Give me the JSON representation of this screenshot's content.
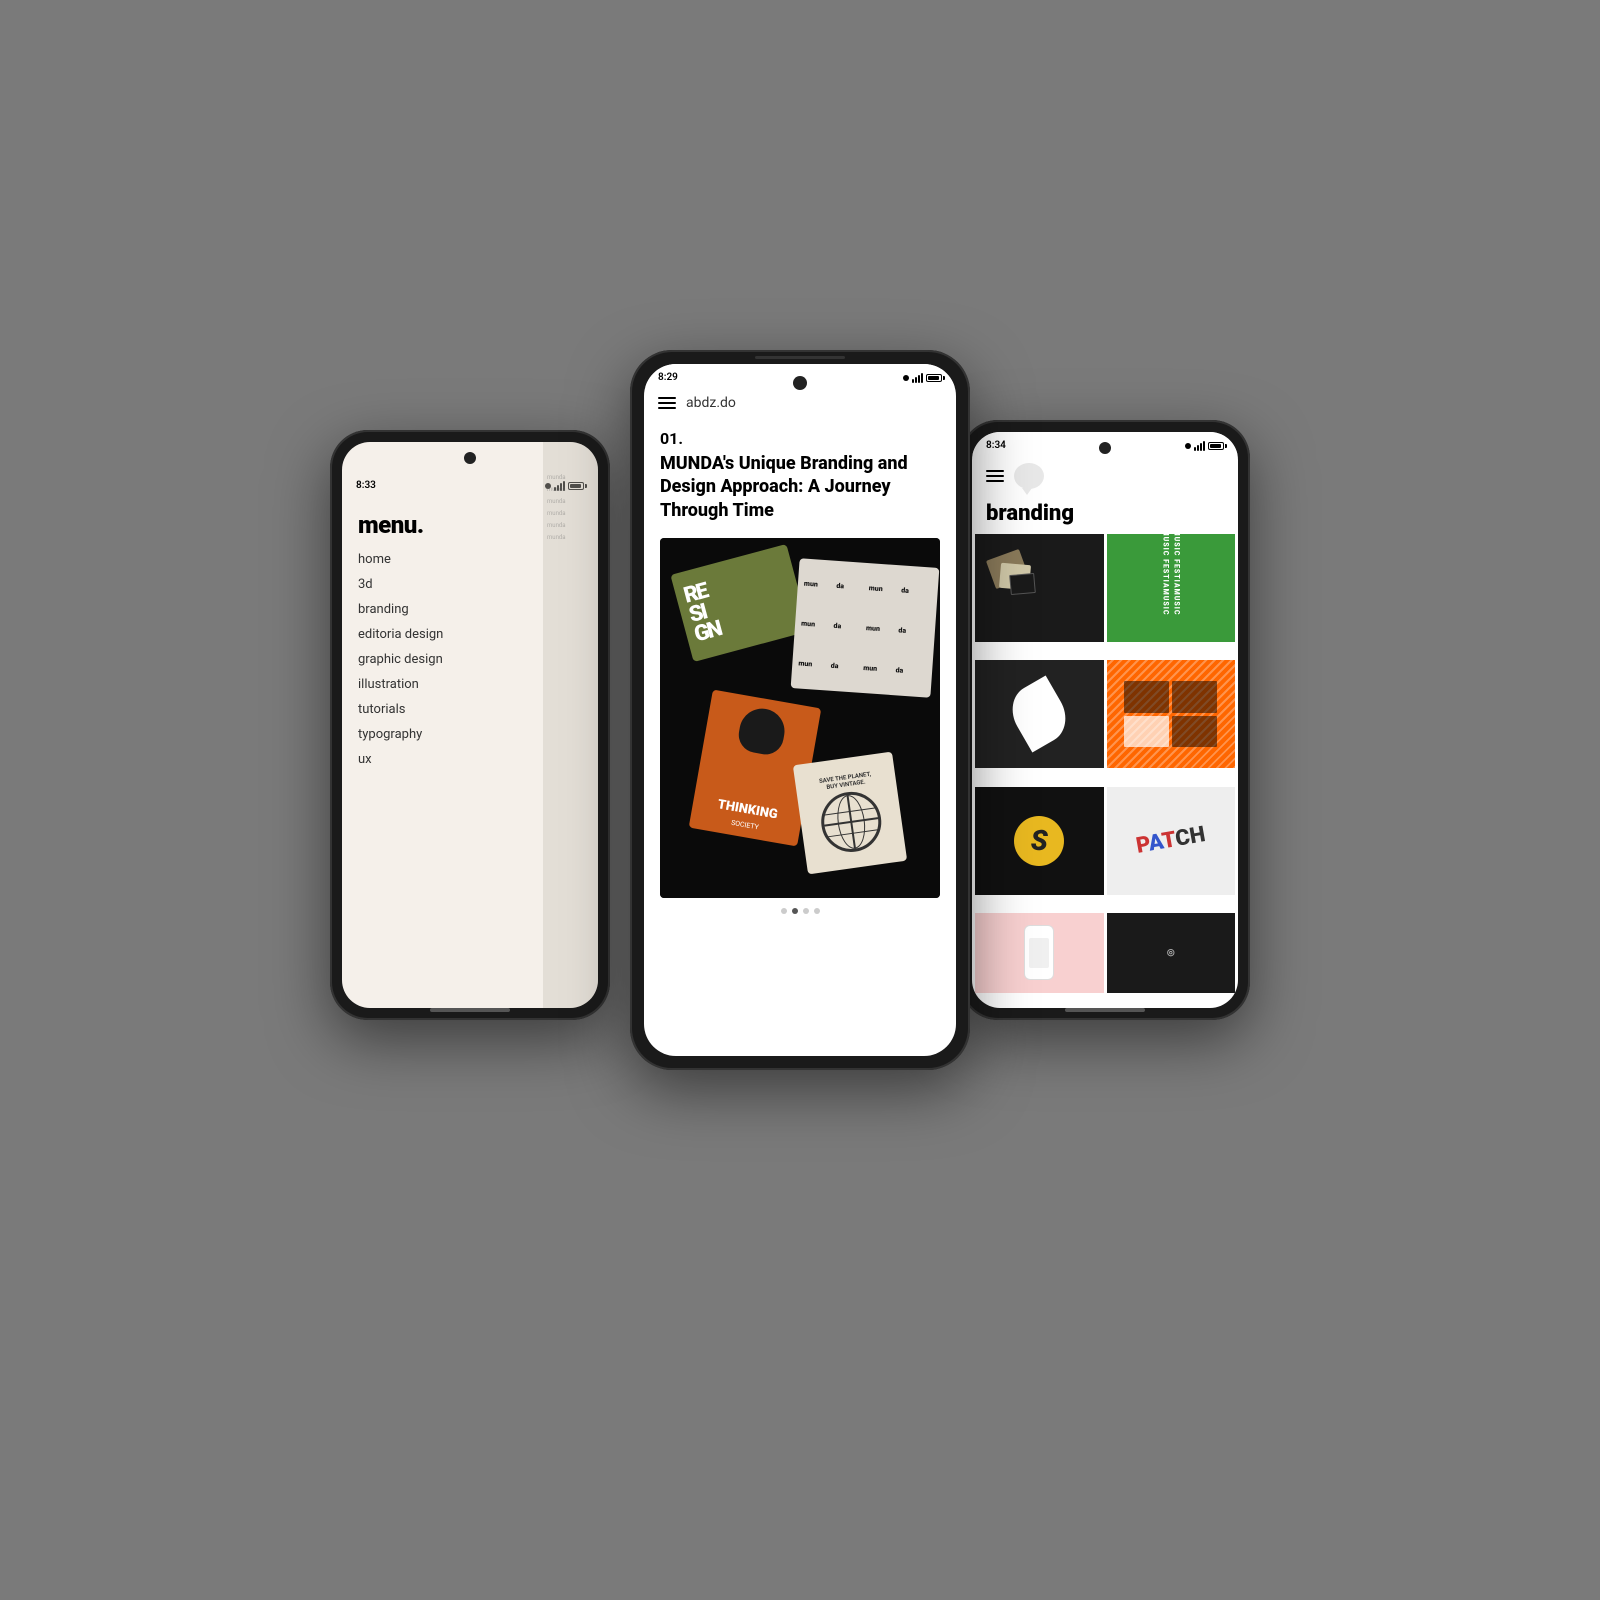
{
  "background": "#7a7a7a",
  "phones": {
    "left": {
      "time": "8:33",
      "title": "menu.",
      "items": [
        "home",
        "3d",
        "branding",
        "editoria design",
        "graphic design",
        "illustration",
        "tutorials",
        "typography",
        "ux"
      ]
    },
    "center": {
      "time": "8:29",
      "domain": "abdz.do",
      "article_number": "01.",
      "article_title": "MUNDA's Unique Branding and Design Approach: A Journey Through Time"
    },
    "right": {
      "time": "8:34",
      "section_title": "branding",
      "grid_items": [
        {
          "label": "cards_dark",
          "bg": "#1a1a1a"
        },
        {
          "label": "festia_green",
          "bg": "#3a9a3a"
        },
        {
          "label": "leaf_dark",
          "bg": "#222"
        },
        {
          "label": "orange_lines",
          "bg": "#ff6600"
        },
        {
          "label": "s_logo_yellow",
          "bg": "#1a1a1a"
        },
        {
          "label": "patch_text",
          "bg": "#f0f0f0"
        },
        {
          "label": "phone_pink",
          "bg": "#ffcccc"
        },
        {
          "label": "dark_item",
          "bg": "#222"
        }
      ]
    }
  }
}
